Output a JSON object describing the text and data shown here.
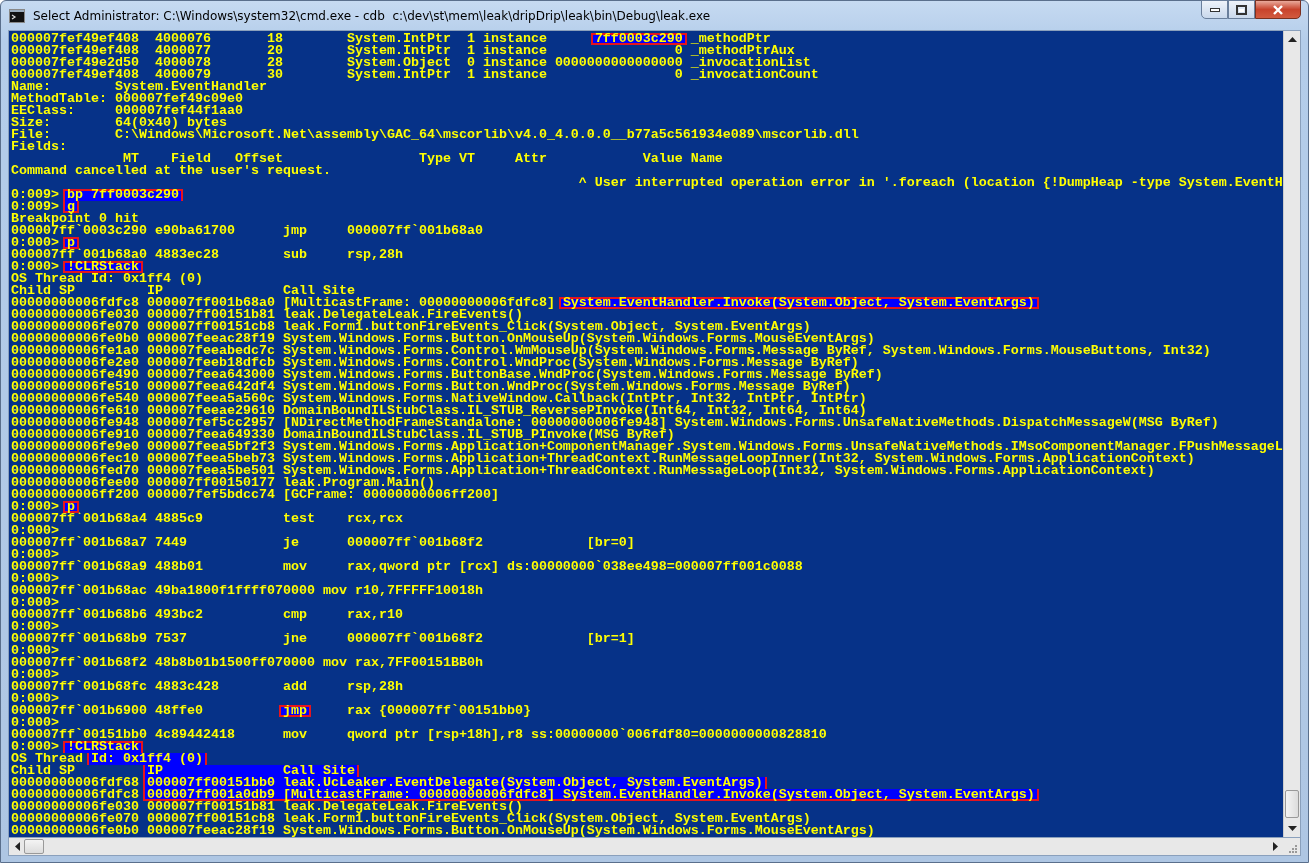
{
  "window": {
    "title": "Select Administrator: C:\\Windows\\system32\\cmd.exe - cdb  c:\\dev\\st\\mem\\leak\\dripDrip\\leak\\bin\\Debug\\leak.exe"
  },
  "console": {
    "lines": [
      {
        "segments": [
          {
            "text": "000007fef49ef408  4000076       18        System.IntPtr  1 instance      ",
            "selected": false
          },
          {
            "text": "7ff0003c290",
            "selected": true
          },
          {
            "text": " _methodPtr",
            "selected": false
          }
        ]
      },
      {
        "text": "000007fef49ef408  4000077       20        System.IntPtr  1 instance                0 _methodPtrAux",
        "selected": false
      },
      {
        "text": "000007fef49e2d50  4000078       28        System.Object  0 instance 0000000000000000 _invocationList",
        "selected": false
      },
      {
        "text": "000007fef49ef408  4000079       30        System.IntPtr  1 instance                0 _invocationCount",
        "selected": false
      },
      {
        "text": "Name:        System.EventHandler",
        "selected": false
      },
      {
        "text": "MethodTable: 000007fef49c09e0",
        "selected": false
      },
      {
        "text": "EEClass:     000007fef44f1aa0",
        "selected": false
      },
      {
        "text": "Size:        64(0x40) bytes",
        "selected": false
      },
      {
        "text": "File:        C:\\Windows\\Microsoft.Net\\assembly\\GAC_64\\mscorlib\\v4.0_4.0.0.0__b77a5c561934e089\\mscorlib.dll",
        "selected": false
      },
      {
        "text": "Fields:",
        "selected": false
      },
      {
        "text": "              MT    Field   Offset                 Type VT     Attr            Value Name",
        "selected": false
      },
      {
        "text": "Command cancelled at the user's request.",
        "selected": false
      },
      {
        "text": "                                                                       ^ User interrupted operation error in '.foreach (location {!DumpHeap -type System.EventH",
        "selected": false
      },
      {
        "segments": [
          {
            "text": "0:009> ",
            "selected": false
          },
          {
            "text": "bp 7ff0003c290",
            "selected": true
          }
        ]
      },
      {
        "segments": [
          {
            "text": "0:009> ",
            "selected": false
          },
          {
            "text": "g",
            "selected": true
          }
        ]
      },
      {
        "text": "Breakpoint 0 hit",
        "selected": false
      },
      {
        "text": "000007ff`0003c290 e90ba61700      jmp     000007ff`001b68a0",
        "selected": false
      },
      {
        "segments": [
          {
            "text": "0:000> ",
            "selected": false
          },
          {
            "text": "p",
            "selected": true
          }
        ]
      },
      {
        "text": "000007ff`001b68a0 4883ec28        sub     rsp,28h",
        "selected": false
      },
      {
        "segments": [
          {
            "text": "0:000> ",
            "selected": false
          },
          {
            "text": "!CLRStack",
            "selected": true
          }
        ]
      },
      {
        "text": "OS Thread Id: 0x1ff4 (0)",
        "selected": false
      },
      {
        "text": "Child SP         IP               Call Site",
        "selected": false
      },
      {
        "segments": [
          {
            "text": "00000000006fdfc8 000007ff001b68a0 [MulticastFrame: 00000000006fdfc8] ",
            "selected": false
          },
          {
            "text": "System.EventHandler.Invoke(System.Object, System.EventArgs)",
            "selected": true
          }
        ]
      },
      {
        "text": "00000000006fe030 000007ff00151b81 leak.DelegateLeak.FireEvents()",
        "selected": false
      },
      {
        "text": "00000000006fe070 000007ff00151cb8 leak.Form1.buttonFireEvents_Click(System.Object, System.EventArgs)",
        "selected": false
      },
      {
        "text": "00000000006fe0b0 000007feeac28f19 System.Windows.Forms.Button.OnMouseUp(System.Windows.Forms.MouseEventArgs)",
        "selected": false
      },
      {
        "text": "00000000006fe1a0 000007feeabedc7c System.Windows.Forms.Control.WmMouseUp(System.Windows.Forms.Message ByRef, System.Windows.Forms.MouseButtons, Int32)",
        "selected": false
      },
      {
        "text": "00000000006fe2e0 000007feeb18dfcb System.Windows.Forms.Control.WndProc(System.Windows.Forms.Message ByRef)",
        "selected": false
      },
      {
        "text": "00000000006fe490 000007feea643000 System.Windows.Forms.ButtonBase.WndProc(System.Windows.Forms.Message ByRef)",
        "selected": false
      },
      {
        "text": "00000000006fe510 000007feea642df4 System.Windows.Forms.Button.WndProc(System.Windows.Forms.Message ByRef)",
        "selected": false
      },
      {
        "text": "00000000006fe540 000007feea5a560c System.Windows.Forms.NativeWindow.Callback(IntPtr, Int32, IntPtr, IntPtr)",
        "selected": false
      },
      {
        "text": "00000000006fe610 000007feeae29610 DomainBoundILStubClass.IL_STUB_ReversePInvoke(Int64, Int32, Int64, Int64)",
        "selected": false
      },
      {
        "text": "00000000006fe948 000007fef5cc2957 [NDirectMethodFrameStandalone: 00000000006fe948] System.Windows.Forms.UnsafeNativeMethods.DispatchMessageW(MSG ByRef)",
        "selected": false
      },
      {
        "text": "00000000006fe910 000007feea649330 DomainBoundILStubClass.IL_STUB_PInvoke(MSG ByRef)",
        "selected": false
      },
      {
        "text": "00000000006fe9e0 000007feea5bf2f3 System.Windows.Forms.Application+ComponentManager.System.Windows.Forms.UnsafeNativeMethods.IMsoComponentManager.FPushMessageL",
        "selected": false
      },
      {
        "text": "00000000006fec10 000007feea5beb73 System.Windows.Forms.Application+ThreadContext.RunMessageLoopInner(Int32, System.Windows.Forms.ApplicationContext)",
        "selected": false
      },
      {
        "text": "00000000006fed70 000007feea5be501 System.Windows.Forms.Application+ThreadContext.RunMessageLoop(Int32, System.Windows.Forms.ApplicationContext)",
        "selected": false
      },
      {
        "text": "00000000006fee00 000007ff00150177 leak.Program.Main()",
        "selected": false
      },
      {
        "text": "00000000006ff200 000007fef5bdcc74 [GCFrame: 00000000006ff200]",
        "selected": false
      },
      {
        "segments": [
          {
            "text": "0:000> ",
            "selected": false
          },
          {
            "text": "p",
            "selected": true
          }
        ]
      },
      {
        "text": "000007ff`001b68a4 4885c9          test    rcx,rcx",
        "selected": false
      },
      {
        "text": "0:000>",
        "selected": false
      },
      {
        "text": "000007ff`001b68a7 7449            je      000007ff`001b68f2             [br=0]",
        "selected": false
      },
      {
        "text": "0:000>",
        "selected": false
      },
      {
        "text": "000007ff`001b68a9 488b01          mov     rax,qword ptr [rcx] ds:00000000`038ee498=000007ff001c0088",
        "selected": false
      },
      {
        "text": "0:000>",
        "selected": false
      },
      {
        "text": "000007ff`001b68ac 49ba1800f1ffff070000 mov r10,7FFFFF10018h",
        "selected": false
      },
      {
        "text": "0:000>",
        "selected": false
      },
      {
        "text": "000007ff`001b68b6 493bc2          cmp     rax,r10",
        "selected": false
      },
      {
        "text": "0:000>",
        "selected": false
      },
      {
        "text": "000007ff`001b68b9 7537            jne     000007ff`001b68f2             [br=1]",
        "selected": false
      },
      {
        "text": "0:000>",
        "selected": false
      },
      {
        "text": "000007ff`001b68f2 48b8b01b1500ff070000 mov rax,7FF00151BB0h",
        "selected": false
      },
      {
        "text": "0:000>",
        "selected": false
      },
      {
        "text": "000007ff`001b68fc 4883c428        add     rsp,28h",
        "selected": false
      },
      {
        "text": "0:000>",
        "selected": false
      },
      {
        "segments": [
          {
            "text": "000007ff`001b6900 48ffe0          ",
            "selected": false
          },
          {
            "text": "jmp",
            "selected": true
          },
          {
            "text": "     rax {000007ff`00151bb0}",
            "selected": false
          }
        ]
      },
      {
        "text": "0:000>",
        "selected": false
      },
      {
        "text": "000007ff`00151bb0 4c89442418      mov     qword ptr [rsp+18h],r8 ss:00000000`006fdf80=0000000000828810",
        "selected": false
      },
      {
        "segments": [
          {
            "text": "0:000> ",
            "selected": false
          },
          {
            "text": "!CLRStack",
            "selected": true
          }
        ]
      },
      {
        "segments": [
          {
            "text": "OS Thread ",
            "selected": false
          },
          {
            "text": "Id: 0x1ff4 (0)",
            "selected": true
          }
        ]
      },
      {
        "segments": [
          {
            "text": "Child SP         ",
            "selected": false
          },
          {
            "text": "IP               Call Site",
            "selected": true
          }
        ]
      },
      {
        "segments": [
          {
            "text": "00000000006fdf68 ",
            "selected": false
          },
          {
            "text": "000007ff00151bb0 leak.UcLeaker.EventDelegate(System.Object, System.EventArgs)",
            "selected": true
          }
        ]
      },
      {
        "segments": [
          {
            "text": "00000000006fdfc8 ",
            "selected": false
          },
          {
            "text": "000007ff001a0db9 [MulticastFrame: 00000000006fdfc8] System.EventHandler.Invoke(System.Object, System.EventArgs)",
            "selected": true
          }
        ]
      },
      {
        "text": "00000000006fe030 000007ff00151b81 leak.DelegateLeak.FireEvents()",
        "selected": false
      },
      {
        "text": "00000000006fe070 000007ff00151cb8 leak.Form1.buttonFireEvents_Click(System.Object, System.EventArgs)",
        "selected": false
      },
      {
        "text": "00000000006fe0b0 000007feeac28f19 System.Windows.Forms.Button.OnMouseUp(System.Windows.Forms.MouseEventArgs)",
        "selected": false
      }
    ]
  }
}
